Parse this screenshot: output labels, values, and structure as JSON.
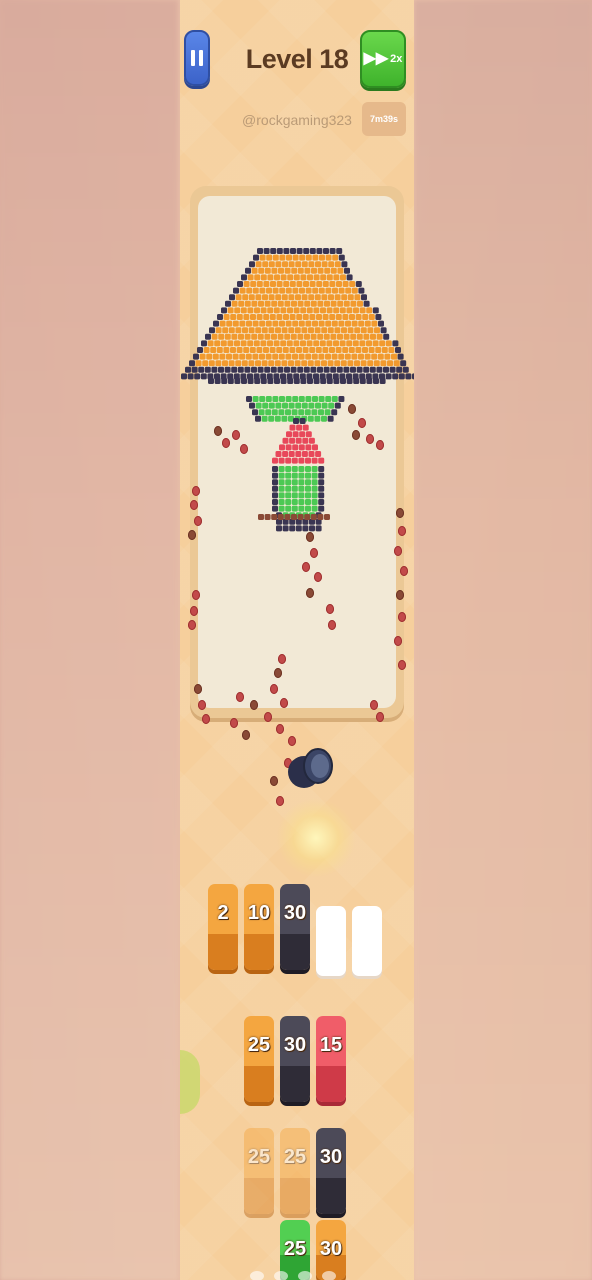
{
  "hud": {
    "level_title": "Level 18",
    "username": "@rockgaming323",
    "speed_label": "2x",
    "timer": "7m39s"
  },
  "colors": {
    "orange": "#f29a2e",
    "dark_navy": "#3a3552",
    "green": "#4cc954",
    "red": "#e8485a",
    "brown": "#8a4a36",
    "board_bg": "#f2e9d6"
  },
  "queue_slots": [
    {
      "value": "2",
      "color": "orange"
    },
    {
      "value": "10",
      "color": "orange"
    },
    {
      "value": "30",
      "color": "dark"
    },
    {
      "value": "",
      "color": "empty"
    },
    {
      "value": "",
      "color": "empty"
    }
  ],
  "stack_rows": [
    [
      {
        "value": "25",
        "color": "orange"
      },
      {
        "value": "30",
        "color": "dark"
      },
      {
        "value": "15",
        "color": "pink"
      }
    ],
    [
      {
        "value": "25",
        "color": "orange",
        "faded": true
      },
      {
        "value": "25",
        "color": "orange",
        "faded": true
      },
      {
        "value": "30",
        "color": "dark"
      }
    ],
    [
      {
        "value": "25",
        "color": "green"
      },
      {
        "value": "30",
        "color": "orange"
      }
    ]
  ],
  "icons": [
    "pause-icon",
    "fast-forward-icon",
    "cannon-icon"
  ]
}
